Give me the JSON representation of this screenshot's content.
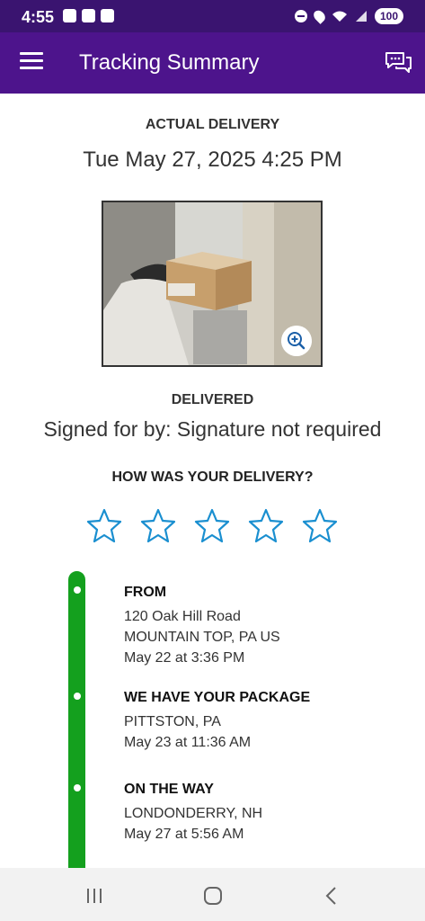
{
  "status_bar": {
    "time": "4:55",
    "battery": "100"
  },
  "header": {
    "title": "Tracking Summary"
  },
  "delivery": {
    "actual_label": "ACTUAL DELIVERY",
    "actual_date": "Tue May 27, 2025 4:25 PM",
    "status": "DELIVERED",
    "signed_for": "Signed for by: Signature not required"
  },
  "rating": {
    "prompt": "HOW WAS YOUR DELIVERY?",
    "stars": 5,
    "selected": 0
  },
  "timeline": [
    {
      "title": "FROM",
      "lines": [
        "120 Oak Hill Road",
        "MOUNTAIN TOP, PA US",
        "May 22 at 3:36 PM"
      ]
    },
    {
      "title": "WE HAVE YOUR PACKAGE",
      "lines": [
        "PITTSTON, PA",
        "May 23 at 11:36 AM"
      ]
    },
    {
      "title": "ON THE WAY",
      "lines": [
        "LONDONDERRY, NH",
        "May 27 at 5:56 AM"
      ]
    }
  ],
  "colors": {
    "status_bar": "#3a1470",
    "app_bar": "#4d148c",
    "timeline": "#14a01e",
    "star": "#1a8fd0"
  },
  "icons": {
    "menu": "menu-icon",
    "chat": "chat-icon",
    "zoom": "zoom-in-icon",
    "star": "star-outline-icon"
  }
}
